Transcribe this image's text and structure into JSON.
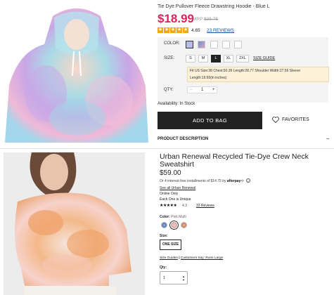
{
  "listing1": {
    "title": "Tie Dye Pullover Fleece Drawstring Hoodie - Blue L",
    "price": "$18.99",
    "mrp_label": "MRP",
    "mrp_value": "$35.75",
    "rating": "4.65",
    "reviews": "23 REVIEWS",
    "color_label": "COLOR:",
    "size_label": "SIZE:",
    "sizes": [
      "S",
      "M",
      "L",
      "XL",
      "2XL"
    ],
    "selected_size": "L",
    "size_guide": "SIZE GUIDE",
    "fit_line1": "Fit US Size:38  Chest:50.39  Length:28.77  Shoulder Width:27.56  Sleeve",
    "fit_line2": "Length:19.69(in inches)",
    "qty_label": "QTY:",
    "qty_minus": "−",
    "qty_value": "1",
    "qty_plus": "+",
    "availability": "Availability: In Stock",
    "add_to_bag": "ADD TO BAG",
    "favorites": "FAVORITES",
    "product_description": "PRODUCT DESCRIPTION",
    "collapse_symbol": "−",
    "accent_color": "#e0215b"
  },
  "listing2": {
    "title_line1": "Urban Renewal Recycled Tie-Dye Crew Neck",
    "title_line2": "Sweatshirt",
    "price": "$59.00",
    "afterpay_text": "Or 4 interest-free installments of $14.75 by",
    "afterpay_logo": "afterpay",
    "info_icon": "i",
    "see_all": "See all Urban Renewal",
    "online_only": "Online Only",
    "each_one_unique": "Each One is Unique",
    "stars": "★★★★★",
    "rating": "4.3",
    "reviews": "33 Reviews",
    "color_label": "Color:",
    "color_value": "Pink Multi",
    "size_label": "Size:",
    "size_value": "ONE SIZE",
    "size_guides": "Size Guides",
    "customers_say": "Customers Say: Runs Large",
    "link_separator": "|",
    "qty_label": "Qty:",
    "qty_value": "1"
  }
}
